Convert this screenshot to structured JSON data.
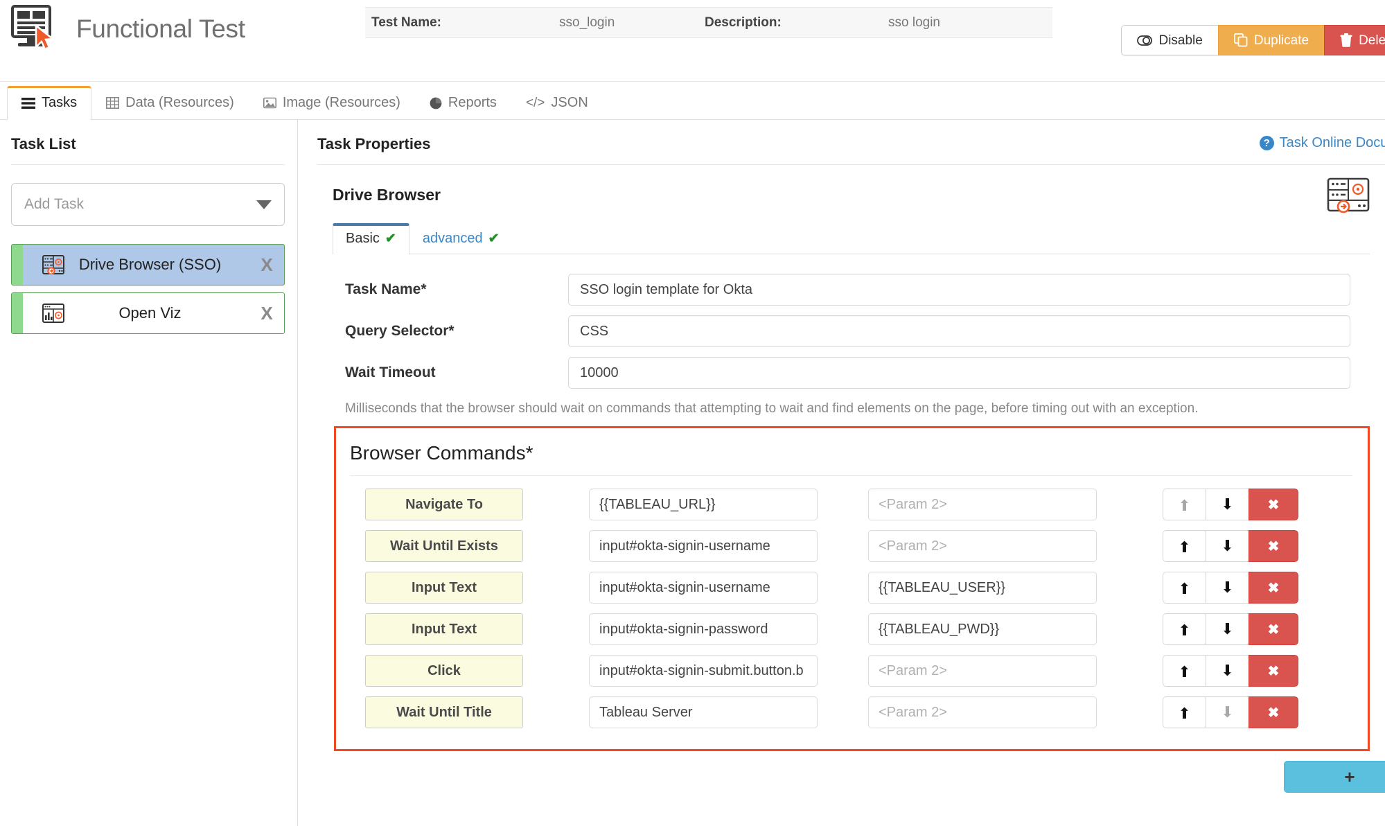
{
  "header": {
    "app_title": "Functional Test",
    "logo_icon": "monitor-document-cursor-icon",
    "meta": {
      "test_name_label": "Test Name:",
      "test_name_value": "sso_login",
      "description_label": "Description:",
      "description_value": "sso login"
    },
    "actions": [
      {
        "label": "Disable",
        "icon": "toggle-off-icon",
        "style": "default"
      },
      {
        "label": "Duplicate",
        "icon": "copy-icon",
        "style": "warning"
      },
      {
        "label": "Delete",
        "icon": "trash-icon",
        "style": "danger"
      }
    ]
  },
  "tabs": [
    {
      "label": "Tasks",
      "icon": "list-rows-icon",
      "active": true
    },
    {
      "label": "Data (Resources)",
      "icon": "table-grid-icon",
      "active": false
    },
    {
      "label": "Image (Resources)",
      "icon": "picture-icon",
      "active": false
    },
    {
      "label": "Reports",
      "icon": "pie-chart-icon",
      "active": false
    },
    {
      "label": "JSON",
      "icon": "code-brackets-icon",
      "active": false
    }
  ],
  "sidebar": {
    "title": "Task List",
    "add_task_placeholder": "Add Task",
    "dropdown_icon": "chevron-down-icon",
    "items": [
      {
        "label": "Drive Browser (SSO)",
        "icon": "drive-browser-icon",
        "close": "X",
        "selected": true
      },
      {
        "label": "Open Viz",
        "icon": "open-viz-icon",
        "close": "X",
        "selected": false
      }
    ]
  },
  "main": {
    "title": "Task Properties",
    "doc_link": "Task Online Documenta",
    "doc_link_icon": "question-mark-icon",
    "card_title": "Drive Browser",
    "card_corner_icon": "drive-browser-large-icon",
    "subtabs": [
      {
        "label": "Basic",
        "check": "✔",
        "active": true
      },
      {
        "label": "advanced",
        "check": "✔",
        "active": false
      }
    ],
    "fields": [
      {
        "label": "Task Name*",
        "value": "SSO login template for Okta"
      },
      {
        "label": "Query Selector*",
        "value": "CSS"
      },
      {
        "label": "Wait Timeout",
        "value": "10000"
      }
    ],
    "help_text": "Milliseconds that the browser should wait on commands that attempting to wait and find elements on the page, before timing out with an exception.",
    "commands": {
      "title": "Browser Commands*",
      "param2_placeholder": "<Param 2>",
      "up_icon": "arrow-up-icon",
      "down_icon": "arrow-down-icon",
      "delete_icon": "x-mark-icon",
      "add_label": "+",
      "rows": [
        {
          "command": "Navigate To",
          "param1": "{{TABLEAU_URL}}",
          "param2": "",
          "up_enabled": false,
          "down_enabled": true
        },
        {
          "command": "Wait Until Exists",
          "param1": "input#okta-signin-username",
          "param2": "",
          "up_enabled": true,
          "down_enabled": true
        },
        {
          "command": "Input Text",
          "param1": "input#okta-signin-username",
          "param2": "{{TABLEAU_USER}}",
          "up_enabled": true,
          "down_enabled": true
        },
        {
          "command": "Input Text",
          "param1": "input#okta-signin-password",
          "param2": "{{TABLEAU_PWD}}",
          "up_enabled": true,
          "down_enabled": true
        },
        {
          "command": "Click",
          "param1": "input#okta-signin-submit.button.b",
          "param2": "",
          "up_enabled": true,
          "down_enabled": true
        },
        {
          "command": "Wait Until Title",
          "param1": "Tableau Server",
          "param2": "",
          "up_enabled": true,
          "down_enabled": false
        }
      ]
    }
  },
  "colors": {
    "accent_orange": "#f0a030",
    "warning": "#f0ad4e",
    "danger": "#d9534f",
    "link_blue": "#3a87c8",
    "selected_blue": "#b0c8e8",
    "green_bar": "#8ed98e",
    "command_yellow": "#fbfbe0",
    "highlight_border": "#f04a23",
    "add_blue": "#5bc0de",
    "subtab_blue": "#4a7ba7"
  }
}
